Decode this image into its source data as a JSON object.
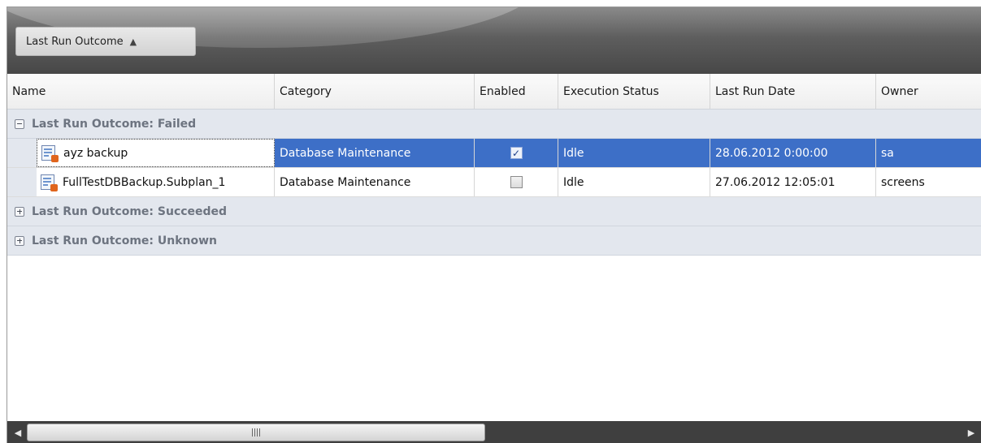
{
  "group_panel": {
    "chip_label": "Last Run Outcome",
    "chip_sort_glyph": "▲"
  },
  "columns": [
    "Name",
    "Category",
    "Enabled",
    "Execution Status",
    "Last Run Date",
    "Owner"
  ],
  "groups": [
    {
      "label": "Last Run Outcome: Failed",
      "expanded": true,
      "rows": [
        {
          "name": "ayz backup",
          "category": "Database Maintenance",
          "enabled": true,
          "enabled_glyph": "✓",
          "status": "Idle",
          "last_run": "28.06.2012 0:00:00",
          "owner": "sa",
          "selected": true
        },
        {
          "name": "FullTestDBBackup.Subplan_1",
          "category": "Database Maintenance",
          "enabled": false,
          "enabled_glyph": "",
          "status": "Idle",
          "last_run": "27.06.2012 12:05:01",
          "owner": "screens",
          "selected": false
        }
      ]
    },
    {
      "label": "Last Run Outcome: Succeeded",
      "expanded": false
    },
    {
      "label": "Last Run Outcome: Unknown",
      "expanded": false
    }
  ],
  "scrollbar": {
    "left_glyph": "◀",
    "right_glyph": "▶"
  },
  "colors": {
    "selection": "#3d6fc7",
    "group_row_bg": "#e3e7ee",
    "panel_bg": "#474747"
  },
  "icons": [
    "job-icon",
    "expand-icon",
    "collapse-icon",
    "checkbox-icon",
    "scroll-left-icon",
    "scroll-right-icon",
    "sort-ascending-icon"
  ]
}
